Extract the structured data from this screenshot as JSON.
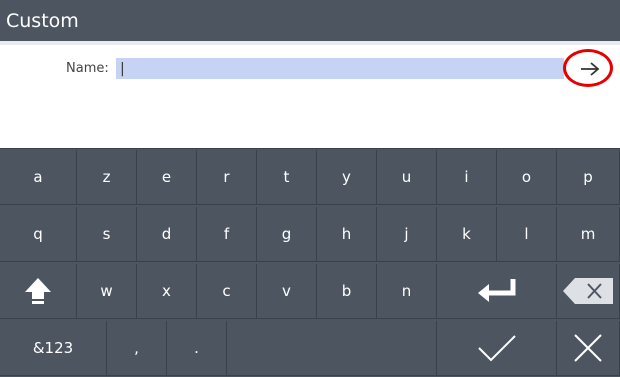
{
  "window": {
    "title": "Custom"
  },
  "form": {
    "name_label": "Name:",
    "name_value": "|"
  },
  "keyboard": {
    "row1": [
      "a",
      "z",
      "e",
      "r",
      "t",
      "y",
      "u",
      "i",
      "o",
      "p"
    ],
    "row2": [
      "q",
      "s",
      "d",
      "f",
      "g",
      "h",
      "j",
      "k",
      "l",
      "m"
    ],
    "row3": [
      "w",
      "x",
      "c",
      "v",
      "b",
      "n"
    ],
    "row4": {
      "symbols_label": "&123",
      "comma": ",",
      "period": "."
    }
  },
  "icons": {
    "next": "arrow-right-icon",
    "shift": "shift-icon",
    "enter": "enter-icon",
    "backspace": "backspace-icon",
    "confirm": "checkmark-icon",
    "cancel": "close-icon"
  },
  "colors": {
    "titlebar": "#4d5660",
    "keyboard": "#4d5660",
    "field_highlight": "#c6d3f5",
    "annotation_ring": "#e60000"
  }
}
